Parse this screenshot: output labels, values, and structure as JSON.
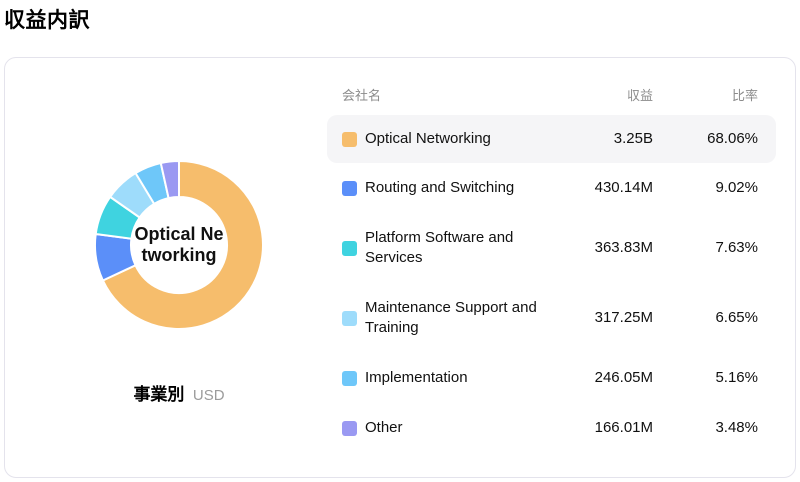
{
  "page": {
    "title": "収益内訳"
  },
  "chart": {
    "center_label_lines": {
      "line1": "Optical Ne",
      "line2": "tworking"
    },
    "caption": "事業別",
    "caption_unit": "USD"
  },
  "table": {
    "headers": {
      "name": "会社名",
      "revenue": "収益",
      "ratio": "比率"
    },
    "rows": [
      {
        "name": "Optical Networking",
        "revenue": "3.25B",
        "ratio": "68.06%",
        "color": "#F6BD6C",
        "highlighted": true
      },
      {
        "name": "Routing and Switching",
        "revenue": "430.14M",
        "ratio": "9.02%",
        "color": "#5B8FF9",
        "highlighted": false
      },
      {
        "name": "Platform Software and Services",
        "revenue": "363.83M",
        "ratio": "7.63%",
        "color": "#3FD3E0",
        "highlighted": false
      },
      {
        "name": "Maintenance Support and Training",
        "revenue": "317.25M",
        "ratio": "6.65%",
        "color": "#9EDCFB",
        "highlighted": false
      },
      {
        "name": "Implementation",
        "revenue": "246.05M",
        "ratio": "5.16%",
        "color": "#6EC7F9",
        "highlighted": false
      },
      {
        "name": "Other",
        "revenue": "166.01M",
        "ratio": "3.48%",
        "color": "#9A99F2",
        "highlighted": false
      }
    ]
  },
  "chart_data": {
    "type": "pie",
    "donut": true,
    "title": "収益内訳",
    "subtitle": "事業別",
    "unit": "USD",
    "start_angle_deg": -90,
    "direction": "clockwise",
    "center_label": "Optical Networking",
    "categories": [
      "Optical Networking",
      "Routing and Switching",
      "Platform Software and Services",
      "Maintenance Support and Training",
      "Implementation",
      "Other"
    ],
    "values": [
      68.06,
      9.02,
      7.63,
      6.65,
      5.16,
      3.48
    ],
    "revenues": [
      "3.25B",
      "430.14M",
      "363.83M",
      "317.25M",
      "246.05M",
      "166.01M"
    ],
    "colors": [
      "#F6BD6C",
      "#5B8FF9",
      "#3FD3E0",
      "#9EDCFB",
      "#6EC7F9",
      "#9A99F2"
    ],
    "legend_position": "right-table"
  }
}
